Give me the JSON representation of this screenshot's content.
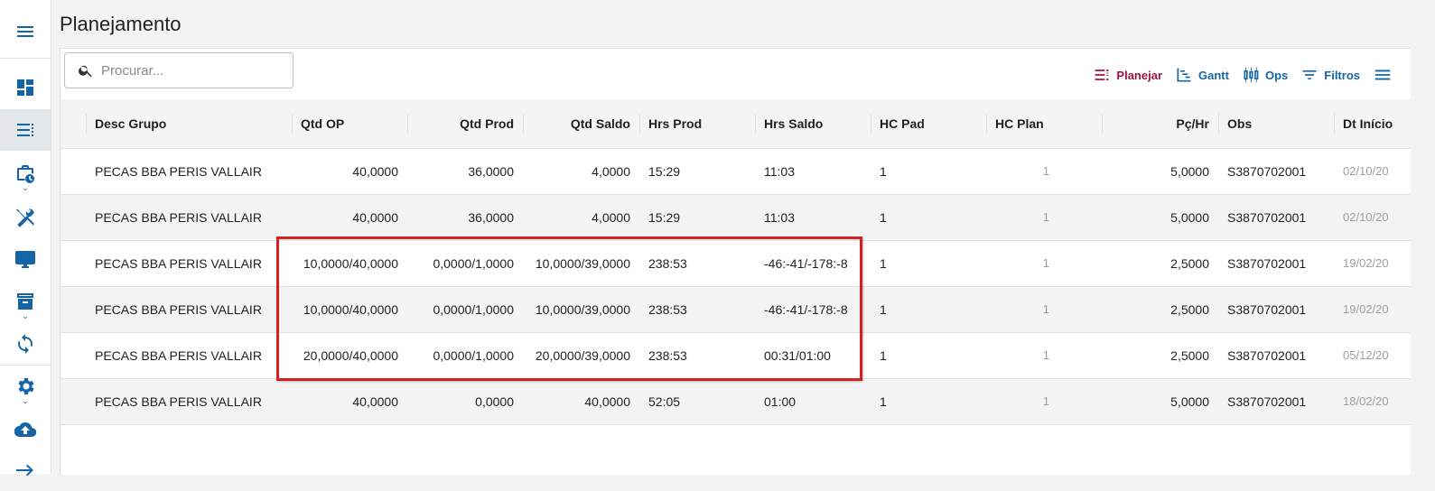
{
  "page": {
    "title": "Planejamento"
  },
  "search": {
    "placeholder": "Procurar..."
  },
  "toolbar": {
    "planejar": "Planejar",
    "gantt": "Gantt",
    "ops": "Ops",
    "filtros": "Filtros"
  },
  "sidebar": {
    "items": [
      {
        "icon": "menu-icon"
      },
      {
        "icon": "dashboard-icon"
      },
      {
        "icon": "list-icon",
        "active": true
      },
      {
        "icon": "briefcase-clock-icon"
      },
      {
        "icon": "tools-icon"
      },
      {
        "icon": "monitor-icon"
      },
      {
        "icon": "archive-icon"
      },
      {
        "icon": "sync-icon"
      },
      {
        "icon": "gear-icon"
      },
      {
        "icon": "cloud-upload-icon"
      },
      {
        "icon": "arrow-right-icon"
      }
    ]
  },
  "table": {
    "columns": [
      "Desc Grupo",
      "Qtd OP",
      "Qtd Prod",
      "Qtd Saldo",
      "Hrs Prod",
      "Hrs Saldo",
      "HC Pad",
      "HC Plan",
      "Pç/Hr",
      "Obs",
      "Dt Início"
    ],
    "rows": [
      [
        "PECAS BBA PERIS VALLAIR",
        "40,0000",
        "36,0000",
        "4,0000",
        "15:29",
        "11:03",
        "1",
        "1",
        "5,0000",
        "S3870702001",
        "02/10/20"
      ],
      [
        "PECAS BBA PERIS VALLAIR",
        "40,0000",
        "36,0000",
        "4,0000",
        "15:29",
        "11:03",
        "1",
        "1",
        "5,0000",
        "S3870702001",
        "02/10/20"
      ],
      [
        "PECAS BBA PERIS VALLAIR",
        "10,0000/40,0000",
        "0,0000/1,0000",
        "10,0000/39,0000",
        "238:53",
        "-46:-41/-178:-8",
        "1",
        "1",
        "2,5000",
        "S3870702001",
        "19/02/20"
      ],
      [
        "PECAS BBA PERIS VALLAIR",
        "10,0000/40,0000",
        "0,0000/1,0000",
        "10,0000/39,0000",
        "238:53",
        "-46:-41/-178:-8",
        "1",
        "1",
        "2,5000",
        "S3870702001",
        "19/02/20"
      ],
      [
        "PECAS BBA PERIS VALLAIR",
        "20,0000/40,0000",
        "0,0000/1,0000",
        "20,0000/39,0000",
        "238:53",
        "00:31/01:00",
        "1",
        "1",
        "2,5000",
        "S3870702001",
        "05/12/20"
      ],
      [
        "PECAS BBA PERIS VALLAIR",
        "40,0000",
        "0,0000",
        "40,0000",
        "52:05",
        "01:00",
        "1",
        "1",
        "5,0000",
        "S3870702001",
        "18/02/20"
      ]
    ]
  },
  "colors": {
    "primary": "#1565a6",
    "accent": "#a5133d",
    "highlight": "#d32020"
  }
}
